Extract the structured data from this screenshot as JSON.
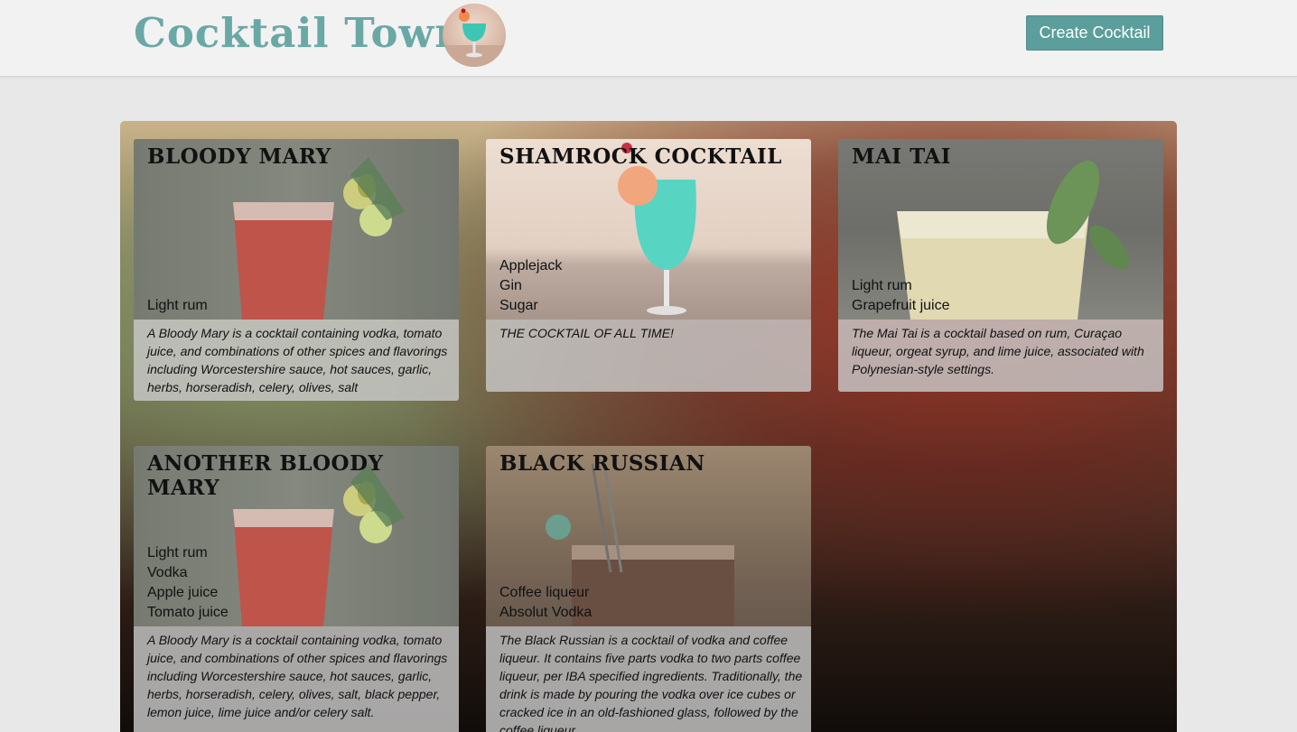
{
  "header": {
    "brand": "Cocktail Town",
    "logo_icon": "cocktail-logo-icon",
    "create_button": "Create Cocktail",
    "accent_color": "#5b9e9c"
  },
  "cocktails": [
    {
      "name": "Bloody Mary",
      "ingredients": [
        "Light rum"
      ],
      "description": "A Bloody Mary is a cocktail containing vodka, tomato juice, and combinations of other spices and flavorings including Worcestershire sauce, hot sauces, garlic, herbs, horseradish, celery, olives, salt"
    },
    {
      "name": "Shamrock Cocktail",
      "ingredients": [
        "Applejack",
        "Gin",
        "Sugar"
      ],
      "description": "THE COCKTAIL OF ALL TIME!"
    },
    {
      "name": "Mai Tai",
      "ingredients": [
        "Light rum",
        "Grapefruit juice"
      ],
      "description": "The Mai Tai is a cocktail based on rum, Curaçao liqueur, orgeat syrup, and lime juice, associated with Polynesian-style settings."
    },
    {
      "name": "Another Bloody Mary",
      "ingredients": [
        "Light rum",
        "Vodka",
        "Apple juice",
        "Tomato juice"
      ],
      "description": "A Bloody Mary is a cocktail containing vodka, tomato juice, and combinations of other spices and flavorings including Worcestershire sauce, hot sauces, garlic, herbs, horseradish, celery, olives, salt, black pepper, lemon juice, lime juice and/or celery salt."
    },
    {
      "name": "Black Russian",
      "ingredients": [
        "Coffee liqueur",
        "Absolut Vodka"
      ],
      "description": "The Black Russian is a cocktail of vodka and coffee liqueur. It contains five parts vodka to two parts coffee liqueur, per IBA specified ingredients. Traditionally, the drink is made by pouring the vodka over ice cubes or cracked ice in an old-fashioned glass, followed by the coffee liqueur."
    }
  ]
}
